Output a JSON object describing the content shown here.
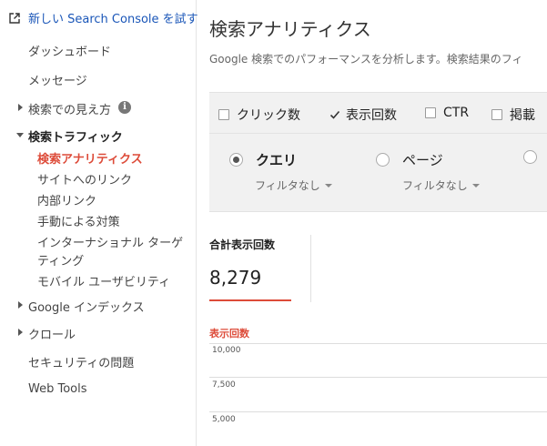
{
  "sidebar": {
    "new_console_link": "新しい Search Console を試す",
    "items": [
      {
        "label": "ダッシュボード"
      },
      {
        "label": "メッセージ"
      },
      {
        "label": "検索での見え方"
      },
      {
        "label": "検索トラフィック"
      },
      {
        "label": "検索アナリティクス"
      },
      {
        "label": "サイトへのリンク"
      },
      {
        "label": "内部リンク"
      },
      {
        "label": "手動による対策"
      },
      {
        "label": "インターナショナル ターゲ"
      },
      {
        "label": "ティング"
      },
      {
        "label": "モバイル ユーザビリティ"
      },
      {
        "label": "Google インデックス"
      },
      {
        "label": "クロール"
      },
      {
        "label": "セキュリティの問題"
      },
      {
        "label": "Web Tools"
      }
    ],
    "info_glyph": "i"
  },
  "main": {
    "title": "検索アナリティクス",
    "description": "Google 検索でのパフォーマンスを分析します。検索結果のフィ",
    "metrics": [
      {
        "label": "クリック数",
        "checked": false
      },
      {
        "label": "表示回数",
        "checked": true
      },
      {
        "label": "CTR",
        "checked": false
      },
      {
        "label": "掲載",
        "checked": false
      }
    ],
    "groups": [
      {
        "label": "クエリ",
        "selected": true,
        "filter": "フィルタなし"
      },
      {
        "label": "ページ",
        "selected": false,
        "filter": "フィルタなし"
      }
    ],
    "total": {
      "label": "合計表示回数",
      "value": "8,279"
    },
    "chart_data": {
      "type": "line",
      "title": "表示回数",
      "y_ticks": [
        "10,000",
        "7,500",
        "5,000"
      ],
      "series": []
    }
  },
  "colors": {
    "accent": "#dd4b39",
    "link": "#1a56b8",
    "panel": "#f1f1f1"
  }
}
